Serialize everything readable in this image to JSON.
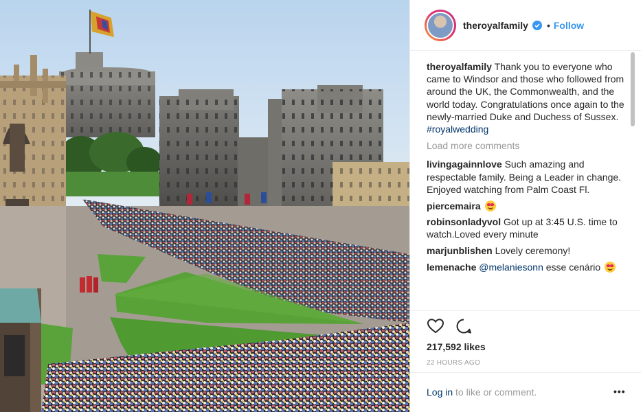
{
  "post": {
    "username": "theroyalfamily",
    "follow_label": "Follow",
    "separator": "•",
    "icons": {
      "verified": "verified-badge-icon",
      "like": "heart-icon",
      "comment": "comment-bubble-icon",
      "more": "more-options-icon"
    },
    "colors": {
      "link_blue": "#3897f0",
      "tag_blue": "#003569",
      "muted": "#999999",
      "text": "#262626"
    }
  },
  "caption": {
    "user": "theroyalfamily",
    "text": "Thank you to everyone who came to Windsor and those who followed from around the UK, the Commonwealth, and the world today. Congratulations once again to the newly-married Duke and Duchess of Sussex.",
    "hashtag": "#royalwedding"
  },
  "load_more": "Load more comments",
  "comments": [
    {
      "user": "livingagainnlove",
      "text": "Such amazing and respectable family. Being a Leader in change. Enjoyed watching from Palm Coast Fl."
    },
    {
      "user": "piercemaira",
      "text": "",
      "emoji": "heart-eyes-emoji"
    },
    {
      "user": "robinsonladyvol",
      "text": "Got up at 3:45 U.S. time to watch.Loved every minute"
    },
    {
      "user": "marjunblishen",
      "text": "Lovely ceremony!"
    },
    {
      "user": "lemenache",
      "mention": "@melaniesonn",
      "text": "esse cenário",
      "emoji": "heart-eyes-emoji"
    }
  ],
  "stats": {
    "likes": "217,592 likes",
    "time": "22 HOURS AGO"
  },
  "footer": {
    "login_link": "Log in",
    "login_rest": " to like or comment.",
    "more": "•••"
  }
}
